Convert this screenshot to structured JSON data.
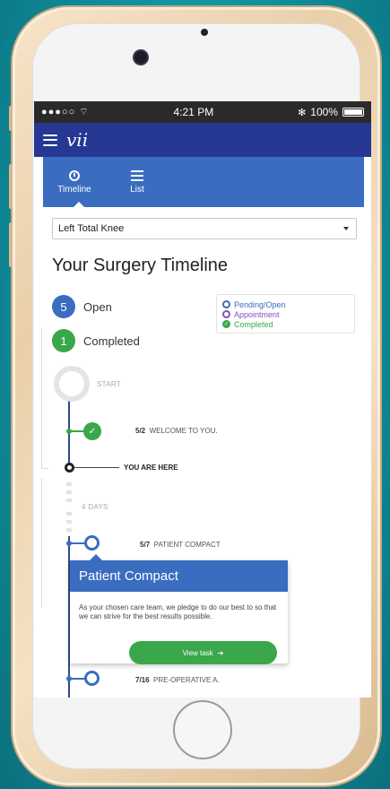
{
  "status_bar": {
    "signal": "●●●○○",
    "time": "4:21 PM",
    "battery": "100%"
  },
  "app_bar": {
    "logo": "vii"
  },
  "tabs": [
    {
      "label": "Timeline",
      "icon": "clock-icon",
      "active": true
    },
    {
      "label": "List",
      "icon": "list-icon",
      "active": false
    }
  ],
  "procedure_select": {
    "value": "Left Total Knee"
  },
  "page_title": "Your Surgery Timeline",
  "counts": {
    "open": {
      "value": "5",
      "label": "Open"
    },
    "completed": {
      "value": "1",
      "label": "Completed"
    }
  },
  "legend": [
    {
      "label": "Pending/Open",
      "color": "#3a6dc0"
    },
    {
      "label": "Appointment",
      "color": "#8a4fc0"
    },
    {
      "label": "Completed",
      "color": "#3aa74a"
    }
  ],
  "timeline": {
    "start_label": "START",
    "events": [
      {
        "date": "5/2",
        "title": "WELCOME TO YOU."
      },
      {
        "date": "5/7",
        "title": "PATIENT COMPACT"
      },
      {
        "date": "7/16",
        "title": "PRE-OPERATIVE A."
      }
    ],
    "you_are_here": "YOU ARE HERE",
    "gap_label": "4 DAYS"
  },
  "popup": {
    "title": "Patient Compact",
    "body": "As your chosen care team, we pledge to do our best to so that we can strive for the best results possible.",
    "button": "View task"
  },
  "colors": {
    "navy": "#263794",
    "blue": "#3a6dc0",
    "green": "#3aa74a",
    "purple": "#8a4fc0"
  }
}
